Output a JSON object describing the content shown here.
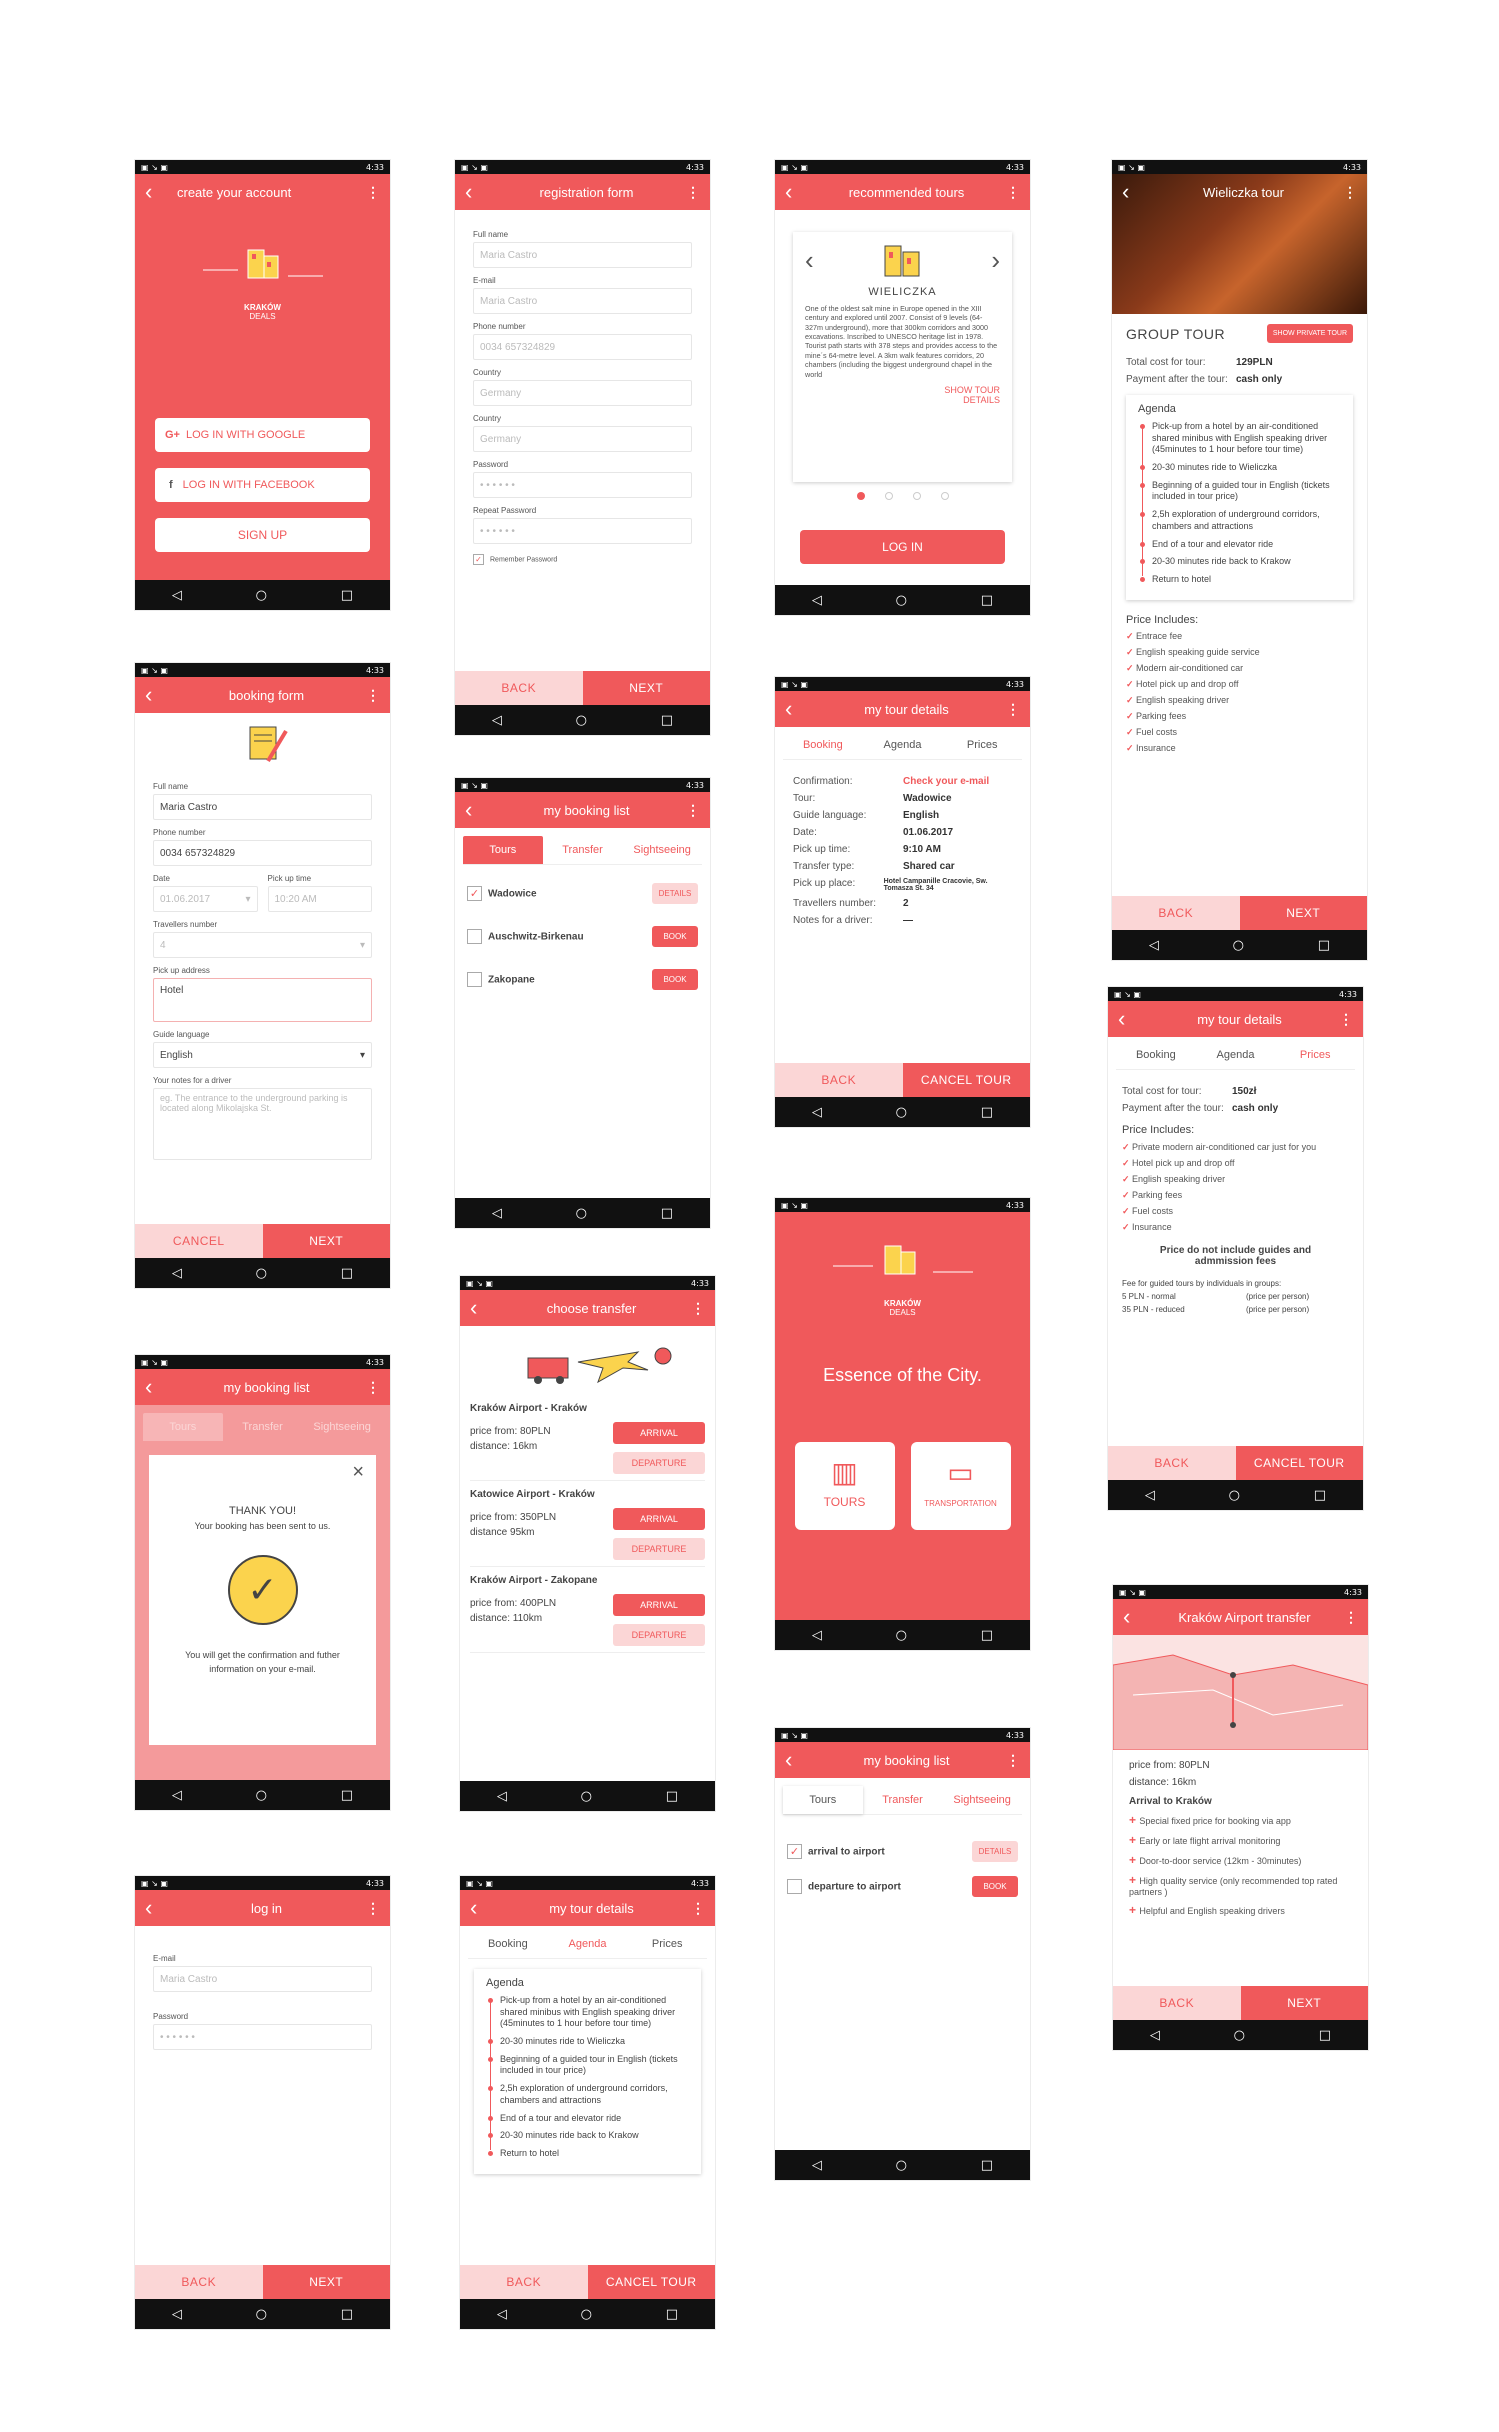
{
  "status": {
    "time": "4:33"
  },
  "nav": {
    "back": "◁",
    "home": "○",
    "recent": "□"
  },
  "s1": {
    "title": "create your account",
    "brand1": "KRAKÓW",
    "brand2": "DEALS",
    "google": "LOG IN WITH GOOGLE",
    "facebook": "LOG IN WITH FACEBOOK",
    "signup": "SIGN UP"
  },
  "s2": {
    "title": "registration form",
    "fields": [
      {
        "label": "Full name",
        "value": "Maria Castro"
      },
      {
        "label": "E-mail",
        "value": "Maria Castro"
      },
      {
        "label": "Phone number",
        "value": "0034 657324829"
      },
      {
        "label": "Country",
        "value": "Germany"
      },
      {
        "label": "Country",
        "value": "Germany"
      },
      {
        "label": "Password",
        "value": "• • • • • •"
      },
      {
        "label": "Repeat Password",
        "value": "• • • • • •"
      }
    ],
    "remember": "Remember Password",
    "back": "BACK",
    "next": "NEXT"
  },
  "s3": {
    "title": "recommended tours",
    "name": "WIELICZKA",
    "desc": "One of the oldest salt mine in Europe opened in the XIII century and explored until 2007. Consist of 9 levels (64-327m underground), more that 300km corridors and 3000 excavations. Inscribed to UNESCO heritage list in 1978. Tourist path starts with 378 steps and provides access to the mine´s 64-metre level. A 3km walk features corridors, 20 chambers (including the biggest underground chapel in the world",
    "show1": "SHOW TOUR",
    "show2": "DETAILS",
    "login": "LOG IN"
  },
  "s4": {
    "title": "Wieliczka tour",
    "group": "GROUP TOUR",
    "private": "SHOW PRIVATE TOUR",
    "cost_k": "Total cost for tour:",
    "cost_v": "129PLN",
    "pay_k": "Payment after the tour:",
    "pay_v": "cash only",
    "agenda": "Agenda",
    "items": [
      "Pick-up from a hotel by an air-conditioned shared minibus with English speaking driver (45minutes to 1 hour before tour time)",
      "20-30 minutes ride to Wieliczka",
      "Beginning of  a guided tour in English (tickets included in tour price)",
      "2,5h exploration of underground corridors, chambers and attractions",
      "End of a tour and elevator ride",
      "20-30 minutes ride back to Krakow",
      "Return to hotel"
    ],
    "price_inc": "Price Includes:",
    "incs": [
      "Entrace fee",
      "English speaking guide service",
      "Modern air-conditioned car",
      "Hotel pick up and drop off",
      "English speaking driver",
      "Parking fees",
      "Fuel costs",
      "Insurance"
    ],
    "back": "BACK",
    "next": "NEXT"
  },
  "s5": {
    "title": "booking form",
    "fields": [
      {
        "label": "Full name",
        "value": "Maria Castro"
      },
      {
        "label": "Phone number",
        "value": "0034 657324829"
      }
    ],
    "date_l": "Date",
    "date_v": "01.06.2017",
    "pick_l": "Pick up time",
    "pick_v": "10:20 AM",
    "trav_l": "Travellers number",
    "trav_v": "4",
    "addr_l": "Pick up address",
    "addr_v": "Hotel",
    "lang_l": "Guide language",
    "lang_v": "English",
    "notes_l": "Your notes for a driver",
    "notes_v": "eg. The entrance to the underground parking is located along Mikolajska St.",
    "cancel": "CANCEL",
    "next": "NEXT"
  },
  "s6": {
    "title": "my booking list",
    "tabs": [
      "Tours",
      "Transfer",
      "Sightseeing"
    ],
    "items": [
      {
        "name": "Wadowice",
        "btn": "DETAILS",
        "checked": "✓"
      },
      {
        "name": "Auschwitz-Birkenau",
        "btn": "BOOK",
        "checked": ""
      },
      {
        "name": "Zakopane",
        "btn": "BOOK",
        "checked": ""
      }
    ]
  },
  "s7": {
    "title": "my tour details",
    "tabs": [
      "Booking",
      "Agenda",
      "Prices"
    ],
    "rows": [
      {
        "k": "Confirmation:",
        "v": "Check your e-mail"
      },
      {
        "k": "Tour:",
        "v": "Wadowice"
      },
      {
        "k": "Guide language:",
        "v": "English"
      },
      {
        "k": "Date:",
        "v": "01.06.2017"
      },
      {
        "k": "Pick up time:",
        "v": "9:10 AM"
      },
      {
        "k": "Transfer type:",
        "v": "Shared car"
      },
      {
        "k": "Pick up place:",
        "v": "Hotel Campanille Cracovie, Sw. Tomasza St. 34"
      },
      {
        "k": "Travellers number:",
        "v": "2"
      },
      {
        "k": "Notes for a driver:",
        "v": "—"
      }
    ],
    "back": "BACK",
    "cancel": "CANCEL TOUR"
  },
  "s8": {
    "title": "my tour details",
    "tabs": [
      "Booking",
      "Agenda",
      "Prices"
    ],
    "cost_k": "Total cost for tour:",
    "cost_v": "150zł",
    "pay_k": "Payment after the tour:",
    "pay_v": "cash only",
    "price_inc": "Price Includes:",
    "incs": [
      "Private modern air-conditioned car just for you",
      "Hotel pick up and drop off",
      "English speaking driver",
      "Parking fees",
      "Fuel costs",
      "Insurance"
    ],
    "note": "Price do not include guides and admmission fees",
    "fee": "Fee for guided tours by individuals in groups:",
    "fee1_k": "5 PLN - normal",
    "fee1_v": "(price per person)",
    "fee2_k": "35 PLN - reduced",
    "fee2_v": "(price per person)",
    "back": "BACK",
    "cancel": "CANCEL TOUR"
  },
  "s9": {
    "title": "my booking list",
    "tabs": [
      "Tours",
      "Transfer",
      "Sightseeing"
    ],
    "thanks": "THANK YOU!",
    "sent": "Your booking has been  sent to us.",
    "info": "You will get the confirmation and futher information on your e-mail."
  },
  "s10": {
    "title": "choose transfer",
    "routes": [
      {
        "name": "Kraków Airport - Kraków",
        "price": "price from: 80PLN",
        "dist": "distance: 16km"
      },
      {
        "name": "Katowice Airport - Kraków",
        "price": "price from: 350PLN",
        "dist": "distance 95km"
      },
      {
        "name": "Kraków Airport - Zakopane",
        "price": "price from: 400PLN",
        "dist": "distance: 110km"
      }
    ],
    "arrival": "ARRIVAL",
    "departure": "DEPARTURE"
  },
  "s11": {
    "brand1": "KRAKÓW",
    "brand2": "DEALS",
    "slogan": "Essence of the City.",
    "tours": "TOURS",
    "transport": "TRANSPORTATION"
  },
  "s12": {
    "title": "Kraków Airport transfer",
    "price": "price from: 80PLN",
    "dist": "distance: 16km",
    "arrival": "Arrival to Kraków",
    "items": [
      "Special fixed price for booking via app",
      "Early or late flight arrival monitoring",
      "Door-to-door service (12km - 30minutes)",
      "High quality service (only recommended top rated partners )",
      "Helpful and English speaking drivers"
    ],
    "back": "BACK",
    "next": "NEXT"
  },
  "s13": {
    "title": "log in",
    "email_l": "E-mail",
    "email_v": "Maria Castro",
    "pass_l": "Password",
    "pass_v": "• • • • • •",
    "back": "BACK",
    "next": "NEXT"
  },
  "s14": {
    "title": "my tour details",
    "tabs": [
      "Booking",
      "Agenda",
      "Prices"
    ],
    "agenda": "Agenda",
    "items": [
      "Pick-up from a hotel by an air-conditioned shared minibus with English speaking driver (45minutes to 1 hour before tour time)",
      "20-30 minutes ride to Wieliczka",
      "Beginning of  a guided tour in English (tickets included in tour price)",
      "2,5h exploration of underground corridors, chambers and attractions",
      "End of a tour and elevator ride",
      "20-30 minutes ride back to Krakow",
      "Return to hotel"
    ],
    "back": "BACK",
    "cancel": "CANCEL TOUR"
  },
  "s15": {
    "title": "my booking list",
    "tabs": [
      "Tours",
      "Transfer",
      "Sightseeing"
    ],
    "items": [
      {
        "name": "arrival to airport",
        "btn": "DETAILS",
        "checked": "✓"
      },
      {
        "name": "departure to airport",
        "btn": "BOOK",
        "checked": ""
      }
    ]
  }
}
